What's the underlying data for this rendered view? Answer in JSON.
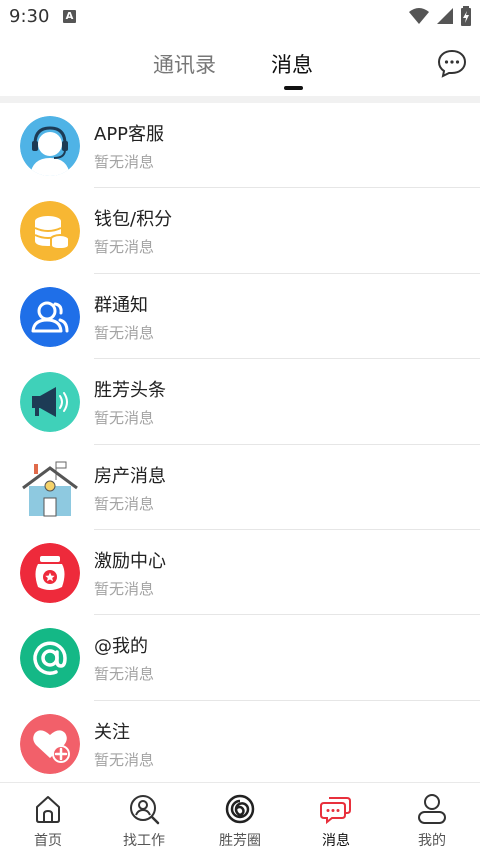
{
  "status_bar": {
    "time": "9:30",
    "notification_badge": "A",
    "icons": [
      "wifi-icon",
      "signal-icon",
      "battery-icon"
    ]
  },
  "header": {
    "tabs": [
      {
        "label": "通讯录",
        "active": false
      },
      {
        "label": "消息",
        "active": true
      }
    ],
    "chat_icon": "chat-bubble-icon"
  },
  "messages": [
    {
      "title": "APP客服",
      "subtitle": "暂无消息",
      "icon": "customer-service-icon",
      "color": "#4fb3e6"
    },
    {
      "title": "钱包/积分",
      "subtitle": "暂无消息",
      "icon": "wallet-coins-icon",
      "color": "#f7b733"
    },
    {
      "title": "群通知",
      "subtitle": "暂无消息",
      "icon": "group-icon",
      "color": "#1f6fe8"
    },
    {
      "title": "胜芳头条",
      "subtitle": "暂无消息",
      "icon": "megaphone-icon",
      "color": "#3fd1b9"
    },
    {
      "title": "房产消息",
      "subtitle": "暂无消息",
      "icon": "house-icon",
      "color": "#8ec9e0"
    },
    {
      "title": "激励中心",
      "subtitle": "暂无消息",
      "icon": "reward-jar-icon",
      "color": "#ee2a3b"
    },
    {
      "title": "@我的",
      "subtitle": "暂无消息",
      "icon": "at-sign-icon",
      "color": "#14b886"
    },
    {
      "title": "关注",
      "subtitle": "暂无消息",
      "icon": "heart-plus-icon",
      "color": "#f2606a"
    }
  ],
  "bottom_nav": [
    {
      "label": "首页",
      "icon": "home-icon",
      "active": false
    },
    {
      "label": "找工作",
      "icon": "job-search-icon",
      "active": false
    },
    {
      "label": "胜芳圈",
      "icon": "circle-swirl-icon",
      "active": false
    },
    {
      "label": "消息",
      "icon": "messages-icon",
      "active": true
    },
    {
      "label": "我的",
      "icon": "profile-icon",
      "active": false
    }
  ],
  "colors": {
    "accent": "#e8303c",
    "text_primary": "#222222",
    "text_secondary": "#a3a3a3"
  }
}
